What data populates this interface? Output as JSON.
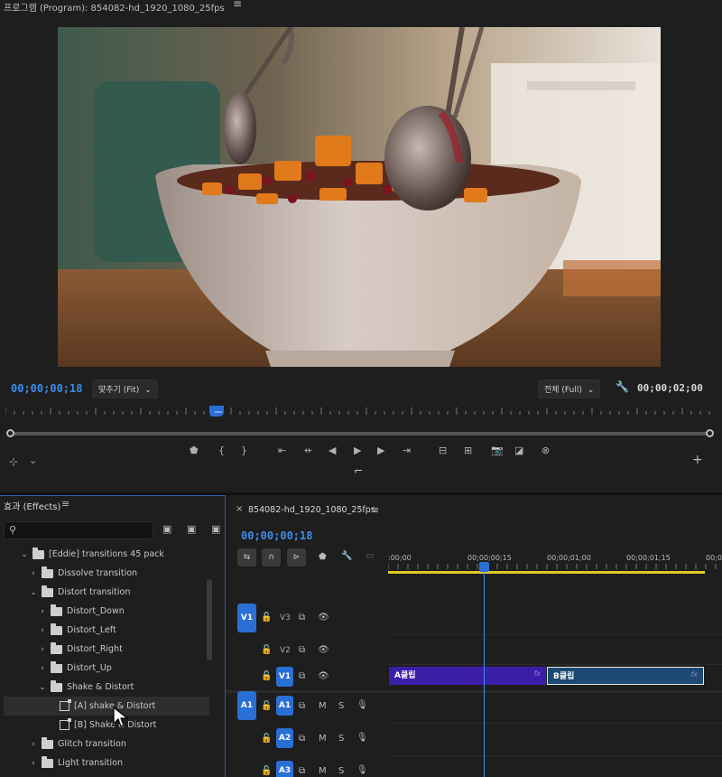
{
  "program": {
    "title": "프로그램 (Program): 854082-hd_1920_1080_25fps",
    "menu_icon": "≡",
    "current_timecode": "00;00;00;18",
    "fit_label": "맞추기 (Fit)",
    "quality_label": "전체 (Full)",
    "duration_timecode": "00;00;02;00",
    "playhead_fraction": 0.3,
    "transport_icons": [
      "marker-icon",
      "in-point-icon",
      "out-point-icon",
      "go-to-in-icon",
      "step-back-icon",
      "play-icon",
      "step-forward-icon",
      "go-to-out-icon",
      "lift-icon",
      "extract-icon",
      "export-frame-icon",
      "comparison-icon",
      "vr-icon"
    ],
    "add_button": "+"
  },
  "effects": {
    "title": "효과 (Effects)",
    "menu_icon": "≡",
    "search_placeholder": "",
    "tree": [
      {
        "label": "[Eddie] transitions 45 pack",
        "depth": 0,
        "expanded": true,
        "type": "folder"
      },
      {
        "label": "Dissolve transition",
        "depth": 1,
        "expanded": false,
        "type": "folder"
      },
      {
        "label": "Distort transition",
        "depth": 1,
        "expanded": true,
        "type": "folder"
      },
      {
        "label": "Distort_Down",
        "depth": 2,
        "expanded": false,
        "type": "folder"
      },
      {
        "label": "Distort_Left",
        "depth": 2,
        "expanded": false,
        "type": "folder"
      },
      {
        "label": "Distort_Right",
        "depth": 2,
        "expanded": false,
        "type": "folder"
      },
      {
        "label": "Distort_Up",
        "depth": 2,
        "expanded": false,
        "type": "folder"
      },
      {
        "label": "Shake & Distort",
        "depth": 2,
        "expanded": true,
        "type": "folder"
      },
      {
        "label": "[A] shake & Distort",
        "depth": 3,
        "type": "item",
        "selected": true
      },
      {
        "label": "[B] Shake & Distort",
        "depth": 3,
        "type": "item"
      },
      {
        "label": "Glitch transition",
        "depth": 1,
        "expanded": false,
        "type": "folder"
      },
      {
        "label": "Light transition",
        "depth": 1,
        "expanded": false,
        "type": "folder"
      }
    ]
  },
  "timeline": {
    "sequence_name": "854082-hd_1920_1080_25fps",
    "close_icon": "×",
    "menu_icon": "≡",
    "current_timecode": "00;00;00;18",
    "ruler_labels": [
      ":00;00",
      "00;00;00;15",
      "00;00;01;00",
      "00;00;01;15",
      "00;00;02;00"
    ],
    "tracks": [
      {
        "name": "V3",
        "source": "V1",
        "target": false
      },
      {
        "name": "V2",
        "target": false
      },
      {
        "name": "V1",
        "target": true
      },
      {
        "name": "A1",
        "source": "A1",
        "target": true
      },
      {
        "name": "A2",
        "target": true
      },
      {
        "name": "A3",
        "target": true
      }
    ],
    "audio_buttons": [
      "M",
      "S"
    ],
    "clips": [
      {
        "label": "A클립",
        "fx": "fx",
        "color": "#3a1ea8"
      },
      {
        "label": "B클립",
        "fx": "fx",
        "color": "#1c4a72"
      }
    ]
  },
  "colors": {
    "accent_blue": "#2a6fd6",
    "timecode_blue": "#3d8dea",
    "clip_a": "#3a1ea8",
    "clip_b": "#1c4a72",
    "work_area": "#e0cc22"
  }
}
